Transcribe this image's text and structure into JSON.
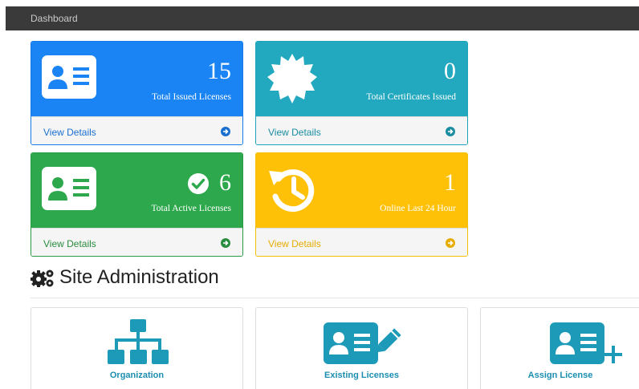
{
  "header": {
    "title": "Dashboard"
  },
  "cards": [
    {
      "value": "15",
      "label": "Total Issued Licenses",
      "link": "View Details",
      "icon": "id-card-icon",
      "color": "#1a84f5"
    },
    {
      "value": "0",
      "label": "Total Certificates Issued",
      "link": "View Details",
      "icon": "certificate-icon",
      "color": "#23a9bf"
    },
    {
      "value": "6",
      "label": "Total Active Licenses",
      "link": "View Details",
      "icon": "id-card-icon",
      "color": "#2ea84c"
    },
    {
      "value": "1",
      "label": "Online Last 24 Hour",
      "link": "View Details",
      "icon": "history-icon",
      "color": "#ffc107"
    }
  ],
  "admin": {
    "title": "Site Administration",
    "items": [
      {
        "label": "Organization",
        "icon": "sitemap-icon"
      },
      {
        "label": "Existing Licenses",
        "icon": "id-card-edit-icon"
      },
      {
        "label": "Assign License",
        "icon": "id-card-add-icon"
      }
    ],
    "accent": "#1c9ab8"
  }
}
